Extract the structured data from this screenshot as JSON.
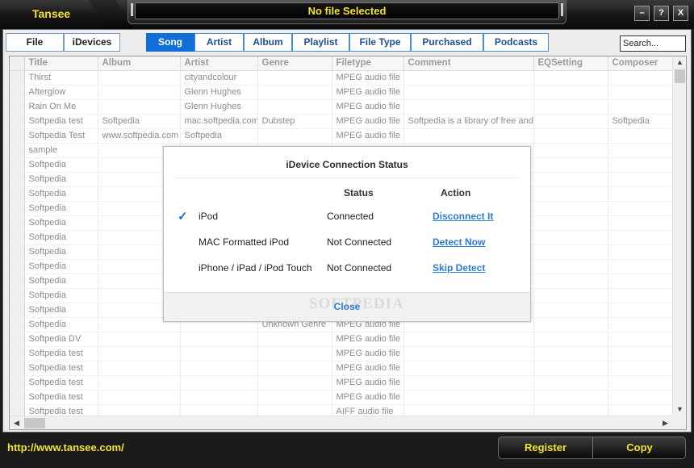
{
  "window": {
    "app_title": "Tansee",
    "now_playing": "No file Selected",
    "buttons": {
      "minimize": "–",
      "help": "?",
      "close": "X"
    }
  },
  "top_tabs": [
    "File",
    "iDevices"
  ],
  "view_tabs": [
    {
      "label": "Song",
      "active": true
    },
    {
      "label": "Artist",
      "active": false
    },
    {
      "label": "Album",
      "active": false
    },
    {
      "label": "Playlist",
      "active": false
    },
    {
      "label": "File Type",
      "active": false
    },
    {
      "label": "Purchased",
      "active": false
    },
    {
      "label": "Podcasts",
      "active": false
    }
  ],
  "search": {
    "value": "Search..."
  },
  "table": {
    "columns": [
      "Title",
      "Album",
      "Artist",
      "Genre",
      "Filetype",
      "Comment",
      "EQSetting",
      "Composer"
    ],
    "rows": [
      [
        "Thirst",
        "",
        "cityandcolour",
        "",
        "MPEG audio file",
        "",
        "",
        ""
      ],
      [
        "Afterglow",
        "",
        "Glenn Hughes",
        "",
        "MPEG audio file",
        "",
        "",
        ""
      ],
      [
        "Rain On Me",
        "",
        "Glenn Hughes",
        "",
        "MPEG audio file",
        "",
        "",
        ""
      ],
      [
        "Softpedia test",
        "Softpedia",
        "mac.softpedia.com",
        "Dubstep",
        "MPEG audio file",
        "Softpedia is a library of free and",
        "",
        "Softpedia"
      ],
      [
        "Softpedia Test",
        "www.softpedia.com",
        "Softpedia",
        "",
        "MPEG audio file",
        "",
        "",
        ""
      ],
      [
        "sample",
        "",
        "",
        "",
        "",
        "",
        "",
        ""
      ],
      [
        "Softpedia",
        "",
        "",
        "",
        "",
        "",
        "",
        ""
      ],
      [
        "Softpedia",
        "",
        "",
        "",
        "",
        "",
        "",
        ""
      ],
      [
        "Softpedia",
        "",
        "",
        "",
        "",
        "",
        "",
        ""
      ],
      [
        "Softpedia",
        "",
        "",
        "",
        "",
        "",
        "",
        ""
      ],
      [
        "Softpedia",
        "",
        "",
        "",
        "",
        "",
        "",
        ""
      ],
      [
        "Softpedia",
        "",
        "",
        "",
        "",
        "",
        "",
        ""
      ],
      [
        "Softpedia",
        "",
        "",
        "",
        "",
        "",
        "",
        ""
      ],
      [
        "Softpedia",
        "",
        "",
        "",
        "",
        "",
        "",
        ""
      ],
      [
        "Softpedia",
        "",
        "",
        "",
        "",
        "",
        "",
        ""
      ],
      [
        "Softpedia",
        "",
        "",
        "",
        "",
        "",
        "",
        ""
      ],
      [
        "Softpedia",
        "",
        "",
        "",
        "",
        "",
        "",
        ""
      ],
      [
        "Softpedia",
        "",
        "",
        "Unknown Genre",
        "MPEG audio file",
        "",
        "",
        ""
      ],
      [
        "Softpedia DV",
        "",
        "",
        "",
        "MPEG audio file",
        "",
        "",
        ""
      ],
      [
        "Softpedia test",
        "",
        "",
        "",
        "MPEG audio file",
        "",
        "",
        ""
      ],
      [
        "Softpedia test",
        "",
        "",
        "",
        "MPEG audio file",
        "",
        "",
        ""
      ],
      [
        "Softpedia test",
        "",
        "",
        "",
        "MPEG audio file",
        "",
        "",
        ""
      ],
      [
        "Softpedia test",
        "",
        "",
        "",
        "MPEG audio file",
        "",
        "",
        ""
      ],
      [
        "Softpedia test",
        "",
        "",
        "",
        "AIFF audio file",
        "",
        "",
        ""
      ]
    ]
  },
  "dialog": {
    "title": "iDevice Connection Status",
    "status_header": "Status",
    "action_header": "Action",
    "devices": [
      {
        "name": "iPod",
        "status": "Connected",
        "action": "Disconnect It",
        "checked": true
      },
      {
        "name": "MAC Formatted iPod",
        "status": "Not Connected",
        "action": "Detect Now",
        "checked": false
      },
      {
        "name": "iPhone / iPad / iPod Touch",
        "status": "Not Connected",
        "action": "Skip Detect",
        "checked": false
      }
    ],
    "close_label": "Close",
    "watermark": "SOFTPEDIA"
  },
  "footer": {
    "url": "http://www.tansee.com/",
    "register_label": "Register",
    "copy_label": "Copy"
  },
  "colors": {
    "accent_yellow": "#f4e42a",
    "tab_active": "#0f6ed8",
    "link_blue": "#2b7bd8"
  }
}
